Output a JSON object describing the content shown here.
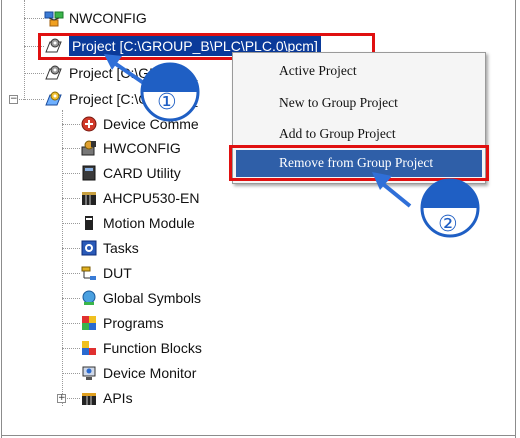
{
  "tree": {
    "items": [
      {
        "label": "NWCONFIG",
        "icon": "nwconfig-icon"
      },
      {
        "label": "Project [C:\\GROUP_B\\PLC\\PLC.0\\pcm]",
        "icon": "project-icon",
        "selected": true
      },
      {
        "label": "Project [C:\\GROUP_",
        "icon": "project-icon"
      },
      {
        "label": "Project [C:\\GROUP_",
        "icon": "project-active-icon"
      },
      {
        "label": "Device Comme",
        "icon": "device-communication-icon"
      },
      {
        "label": "HWCONFIG",
        "icon": "hwconfig-icon"
      },
      {
        "label": "CARD Utility",
        "icon": "card-utility-icon"
      },
      {
        "label": "AHCPU530-EN",
        "icon": "cpu-icon"
      },
      {
        "label": "Motion Module",
        "icon": "motion-module-icon"
      },
      {
        "label": "Tasks",
        "icon": "tasks-icon"
      },
      {
        "label": "DUT",
        "icon": "dut-icon"
      },
      {
        "label": "Global Symbols",
        "icon": "global-symbols-icon"
      },
      {
        "label": "Programs",
        "icon": "programs-icon"
      },
      {
        "label": "Function Blocks",
        "icon": "function-blocks-icon"
      },
      {
        "label": "Device Monitor",
        "icon": "device-monitor-icon"
      },
      {
        "label": "APIs",
        "icon": "apis-icon"
      }
    ],
    "expander_minus": "−",
    "expander_plus": "+"
  },
  "context_menu": {
    "items": [
      "Active Project",
      "New to Group Project",
      "Add to Group Project",
      "Remove from Group Project"
    ],
    "highlighted": "Remove from Group Project"
  },
  "callouts": {
    "step1": "①",
    "step2": "②",
    "color": "#e01010",
    "badge_color": "#1f5fc4",
    "arrow_color": "#2f6fd8"
  }
}
